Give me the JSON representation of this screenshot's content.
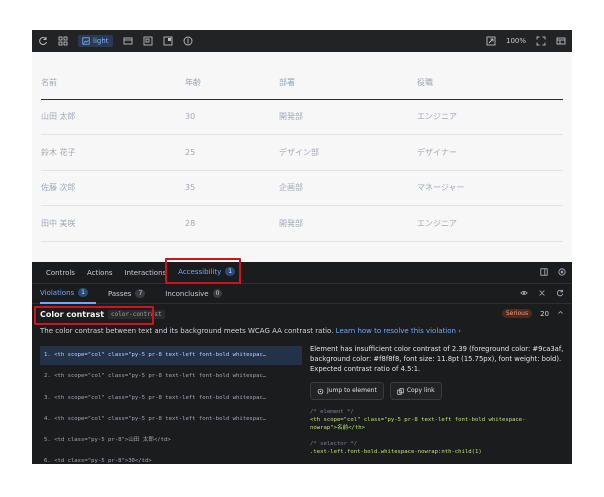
{
  "toolbar": {
    "theme_label": "light",
    "zoom": "100%"
  },
  "table": {
    "headers": [
      "名前",
      "年齢",
      "部署",
      "役職"
    ],
    "rows": [
      [
        "山田 太郎",
        "30",
        "開発部",
        "エンジニア"
      ],
      [
        "鈴木 花子",
        "25",
        "デザイン部",
        "デザイナー"
      ],
      [
        "佐藤 次郎",
        "35",
        "企画部",
        "マネージャー"
      ],
      [
        "田中 美咲",
        "28",
        "開発部",
        "エンジニア"
      ]
    ]
  },
  "panel": {
    "tabs": [
      {
        "label": "Controls"
      },
      {
        "label": "Actions"
      },
      {
        "label": "Interactions"
      },
      {
        "label": "Accessibility",
        "count": "1"
      }
    ],
    "subtabs": [
      {
        "label": "Violations",
        "count": "1"
      },
      {
        "label": "Passes",
        "count": "7"
      },
      {
        "label": "Inconclusive",
        "count": "0"
      }
    ],
    "rule": {
      "title": "Color contrast",
      "id": "color-contrast",
      "severity": "Serious",
      "count": "20",
      "description": "The color contrast between text and its background meets WCAG AA contrast ratio.",
      "link": "Learn how to resolve this violation",
      "link_arrow": "›"
    },
    "nodes": [
      "1. <th scope=\"col\" class=\"py-5 pr-8 text-left font-bold whitespac…",
      "2. <th scope=\"col\" class=\"py-5 pr-8 text-left font-bold whitespac…",
      "3. <th scope=\"col\" class=\"py-5 pr-8 text-left font-bold whitespac…",
      "4. <th scope=\"col\" class=\"py-5 pr-8 text-left font-bold whitespac…",
      "5. <td class=\"py-5 pr-8\">山田 太郎</td>",
      "6. <td class=\"py-5 pr-8\">30</td>"
    ],
    "detail": {
      "message": "Element has insufficient color contrast of 2.39 (foreground color: #9ca3af, background color: #f8f8f8, font size: 11.8pt (15.75px), font weight: bold). Expected contrast ratio of 4.5:1.",
      "jump_button": "Jump to element",
      "copy_button": "Copy link",
      "element_comment": "/* element */",
      "element_code_1": "<th scope=\"col\" class=\"py-5 pr-8 text-left font-bold whitespace-",
      "element_code_2": "nowrap\">名前</th>",
      "selector_comment": "/* selector */",
      "selector_code": ".text-left.font-bold.whitespace-nowrap:nth-child(1)"
    }
  },
  "colors": {
    "accent": "#6ea8ff",
    "highlight": "#d0141b",
    "severity": "#ff9a6a"
  }
}
